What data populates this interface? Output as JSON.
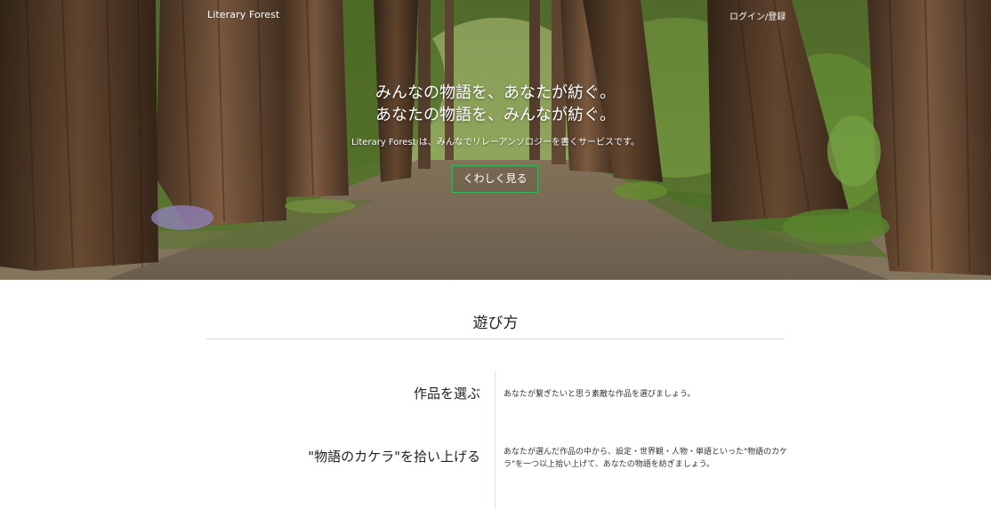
{
  "header": {
    "brand": "Literary Forest",
    "login_label": "ログイン/登録"
  },
  "hero": {
    "title_line1": "みんなの物語を、あなたが紡ぐ。",
    "title_line2": "あなたの物語を、みんなが紡ぐ。",
    "subtitle": "Literary Forest は、みんなでリレーアンソロジーを書くサービスです。",
    "button_label": "くわしく見る",
    "button_border_color": "#36b85a"
  },
  "how_to_play": {
    "title": "遊び方",
    "steps": [
      {
        "heading": "作品を選ぶ",
        "description": "あなたが繋ぎたいと思う素敵な作品を選びましょう。"
      },
      {
        "heading": "\"物語のカケラ\"を拾い上げる",
        "description": "あなたが選んだ作品の中から、設定・世界観・人物・単語といった\"物語のカケラ\"を一つ以上拾い上げて、あなたの物語を紡ぎましょう。"
      }
    ]
  }
}
